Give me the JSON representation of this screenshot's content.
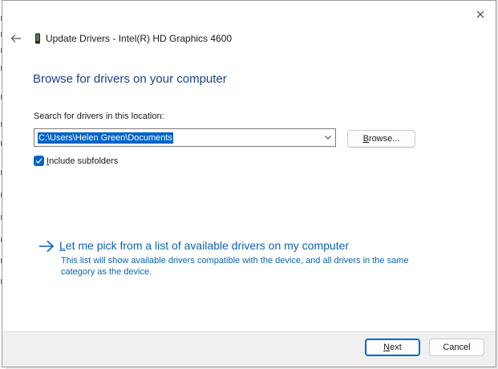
{
  "window": {
    "title": "Update Drivers - Intel(R) HD Graphics 4600",
    "close_icon": "close-icon",
    "back_icon": "back-arrow-icon",
    "device_icon": "device-icon"
  },
  "main": {
    "heading": "Browse for drivers on your computer",
    "search_label": "Search for drivers in this location:",
    "path_value": "C:\\Users\\Helen Green\\Documents",
    "browse_label_mnemonic": "B",
    "browse_label_rest": "rowse...",
    "include_mnemonic": "I",
    "include_rest": "nclude subfolders",
    "include_checked": true,
    "pick_mnemonic": "L",
    "pick_rest": "et me pick from a list of available drivers on my computer",
    "pick_description": "This list will show available drivers compatible with the device, and all drivers in the same category as the device."
  },
  "footer": {
    "next_mnemonic": "N",
    "next_rest": "ext",
    "cancel_label": "Cancel"
  },
  "colors": {
    "accent": "#0064c8",
    "heading": "#1c3f8c",
    "link": "#0a64b4"
  }
}
